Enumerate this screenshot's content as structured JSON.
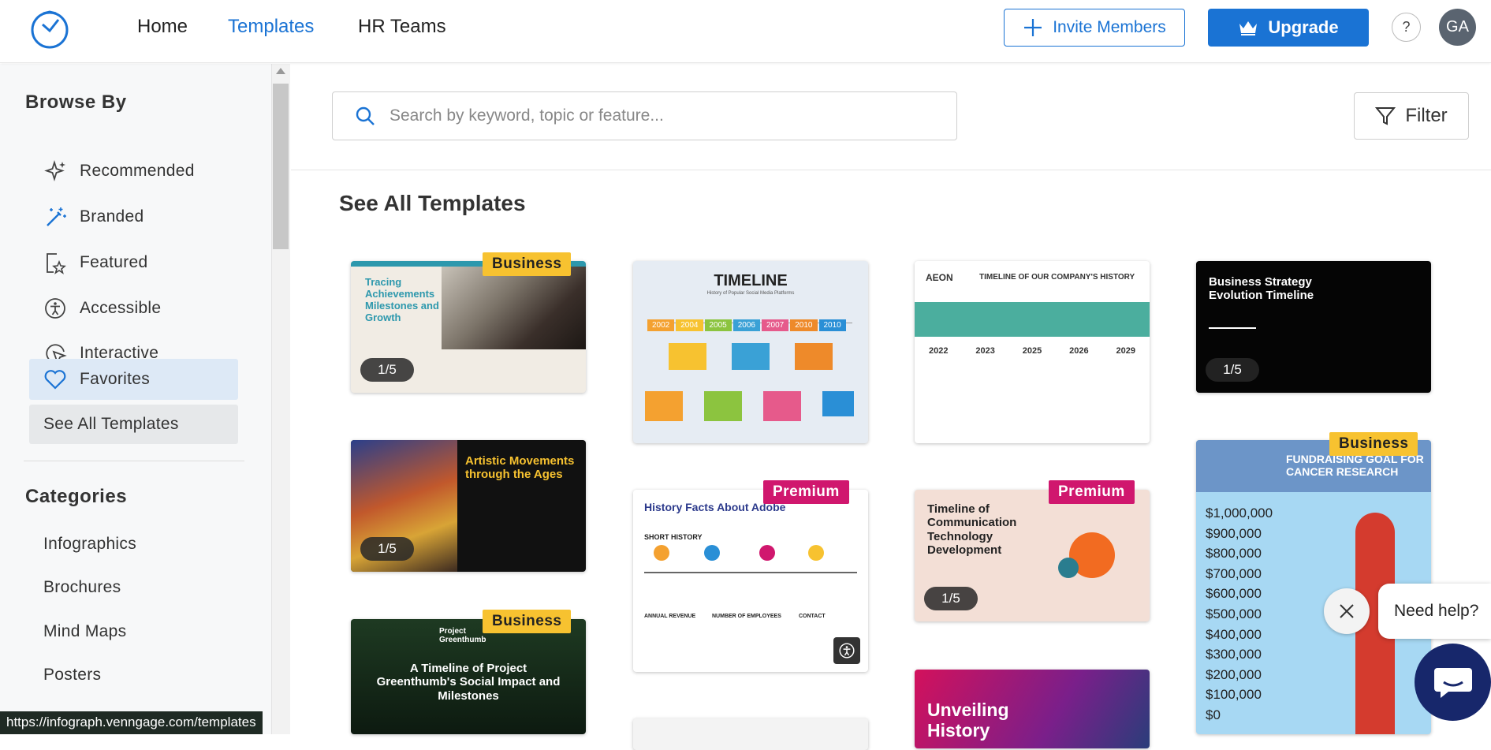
{
  "nav": {
    "home": "Home",
    "templates": "Templates",
    "hr_teams": "HR Teams"
  },
  "header": {
    "invite_label": "Invite Members",
    "upgrade_label": "Upgrade",
    "help_label": "?",
    "avatar_initials": "GA"
  },
  "sidebar": {
    "browse_heading": "Browse By",
    "browse_items": [
      {
        "label": "Recommended",
        "icon": "sparkle-icon"
      },
      {
        "label": "Branded",
        "icon": "magic-wand-icon"
      },
      {
        "label": "Featured",
        "icon": "featured-star-icon"
      },
      {
        "label": "Accessible",
        "icon": "accessibility-icon"
      },
      {
        "label": "Interactive",
        "icon": "cursor-click-icon"
      },
      {
        "label": "Favorites",
        "icon": "heart-icon"
      },
      {
        "label": "See All Templates"
      }
    ],
    "categories_heading": "Categories",
    "categories": [
      "Infographics",
      "Brochures",
      "Mind Maps",
      "Posters"
    ]
  },
  "search": {
    "placeholder": "Search by keyword, topic or feature..."
  },
  "filter_label": "Filter",
  "main": {
    "heading": "See All Templates"
  },
  "cards": {
    "c1": {
      "title": "Tracing Achievements Milestones and Growth",
      "badge": "Business",
      "pager": "1/5"
    },
    "c2": {
      "title": "TIMELINE",
      "subtitle": "History of Popular Social Media Platforms",
      "years": [
        "2002",
        "2004",
        "2005",
        "2006",
        "2007",
        "2010",
        "2010"
      ]
    },
    "c3": {
      "logo": "AEON",
      "title": "TIMELINE OF OUR COMPANY'S HISTORY",
      "years": [
        "2022",
        "2023",
        "2025",
        "2026",
        "2029"
      ]
    },
    "c4": {
      "title": "Business Strategy Evolution Timeline",
      "pager": "1/5"
    },
    "c5": {
      "title": "Artistic Movements through the Ages",
      "pager": "1/5"
    },
    "c6": {
      "title": "History Facts About Adobe",
      "badge": "Premium",
      "section1": "SHORT HISTORY",
      "section2": "ANNUAL REVENUE",
      "section3": "NUMBER OF EMPLOYEES",
      "section4": "CONTACT"
    },
    "c7": {
      "title": "Timeline of Communication Technology Development",
      "badge": "Premium",
      "pager": "1/5"
    },
    "c8": {
      "title": "FUNDRAISING GOAL FOR CANCER RESEARCH",
      "badge": "Business",
      "amounts": [
        "$1,000,000",
        "$900,000",
        "$800,000",
        "$700,000",
        "$600,000",
        "$500,000",
        "$400,000",
        "$300,000",
        "$200,000",
        "$100,000",
        "$0"
      ]
    },
    "c9": {
      "title": "A Timeline of Project Greenthumb's Social Impact and Milestones",
      "brand": "Project Greenthumb",
      "badge": "Business"
    },
    "c10": {
      "title": "Unveiling History"
    }
  },
  "chat": {
    "help_text": "Need help?"
  },
  "status_url": "https://infograph.venngage.com/templates"
}
